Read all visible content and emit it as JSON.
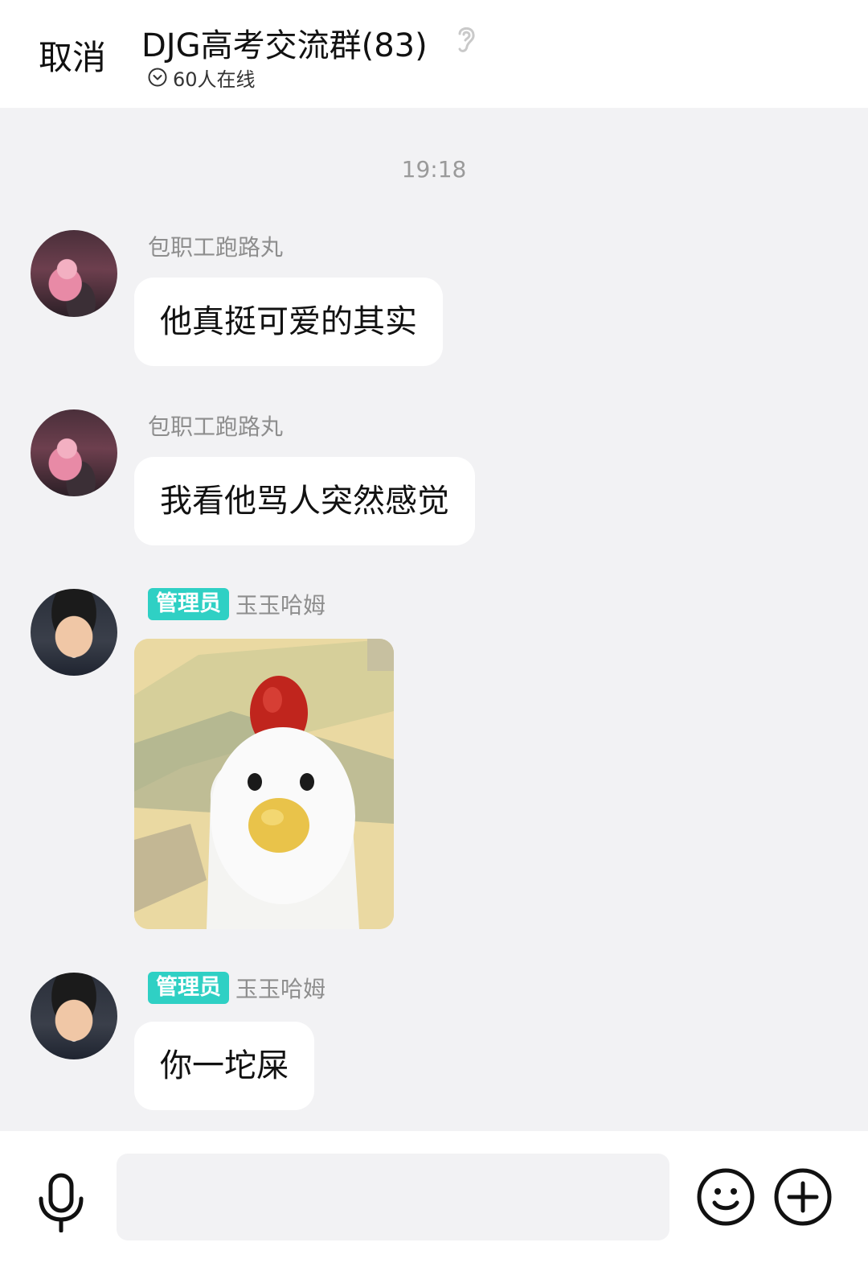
{
  "header": {
    "cancel_label": "取消",
    "title": "DJG高考交流群(83)",
    "online_text": "60人在线"
  },
  "chat": {
    "timestamp": "19:18",
    "messages": [
      {
        "sender": "包职工跑路丸",
        "text": "他真挺可爱的其实",
        "avatar": "anime-girl-avatar"
      },
      {
        "sender": "包职工跑路丸",
        "text": "我看他骂人突然感觉",
        "avatar": "anime-girl-avatar"
      },
      {
        "badge": "管理员",
        "sender": "玉玉哈姆",
        "image": "chicken-sticker",
        "avatar": "laughing-man-avatar"
      },
      {
        "badge": "管理员",
        "sender": "玉玉哈姆",
        "text": "你一坨屎",
        "avatar": "laughing-man-avatar"
      }
    ]
  },
  "input": {
    "placeholder": "",
    "icons": [
      "microphone-icon",
      "emoji-icon",
      "plus-icon"
    ]
  },
  "colors": {
    "background": "#f2f2f4",
    "badge": "#2fd0c4",
    "bubble": "#ffffff"
  }
}
